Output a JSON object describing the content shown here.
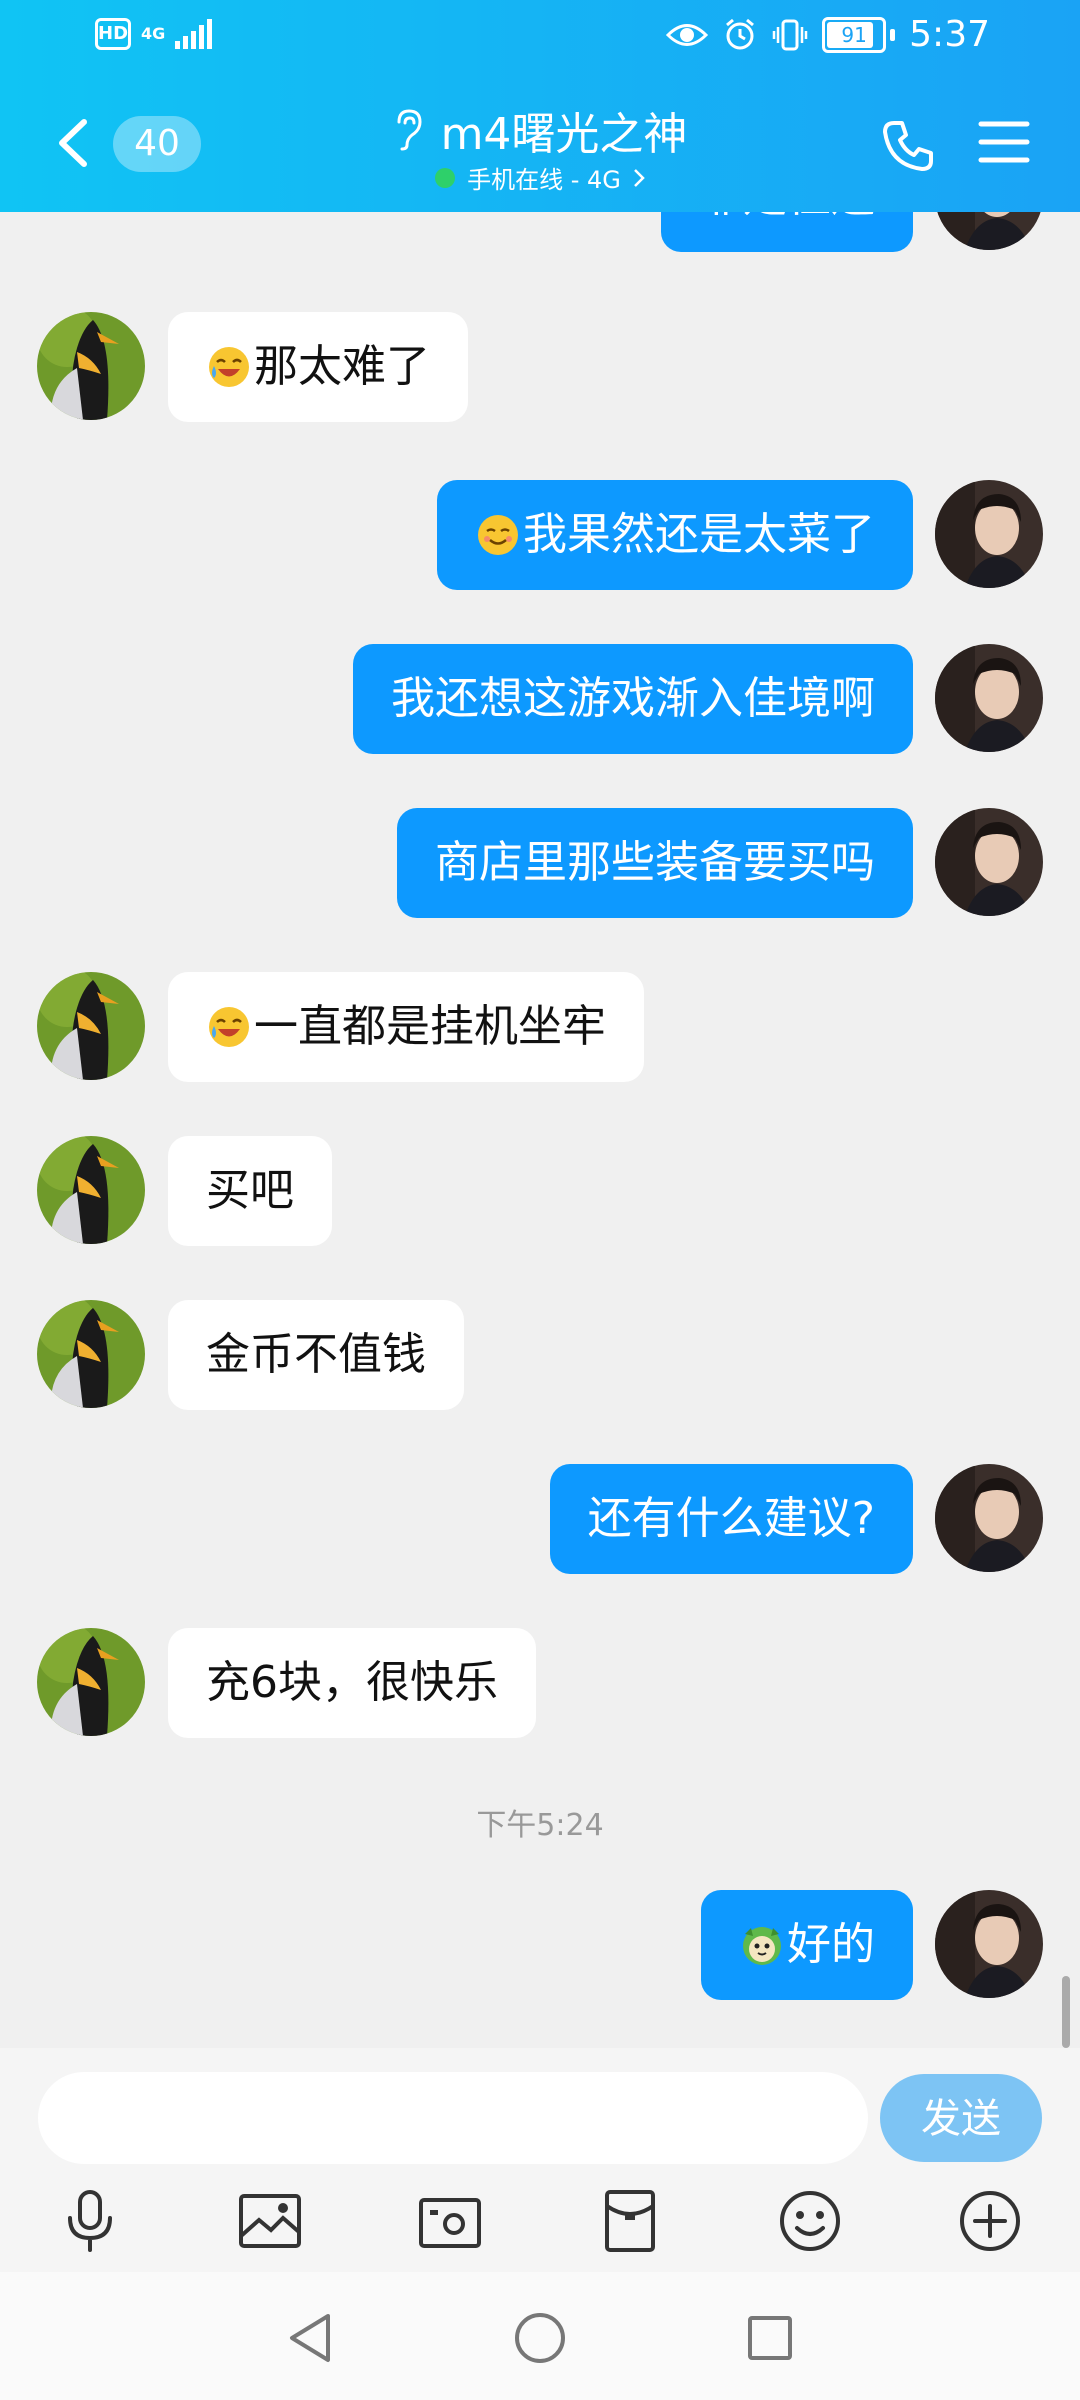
{
  "status_bar": {
    "network_type": "4G",
    "battery_level": "91",
    "time": "5:37"
  },
  "header": {
    "unread_count": "40",
    "contact_name": "m4曙光之神",
    "online_status": "手机在线 - 4G",
    "background_color": "#1aa3f5"
  },
  "messages": [
    {
      "side": "right",
      "text": "靠走位还",
      "emoji": null
    },
    {
      "side": "left",
      "text": "那太难了",
      "emoji": "tearful-laugh"
    },
    {
      "side": "right",
      "text": "我果然还是太菜了",
      "emoji": "content-smile"
    },
    {
      "side": "right",
      "text": "我还想这游戏渐入佳境啊",
      "emoji": null
    },
    {
      "side": "right",
      "text": "商店里那些装备要买吗",
      "emoji": null
    },
    {
      "side": "left",
      "text": "一直都是挂机坐牢",
      "emoji": "tearful-laugh"
    },
    {
      "side": "left",
      "text": "买吧",
      "emoji": null
    },
    {
      "side": "left",
      "text": "金币不值钱",
      "emoji": null
    },
    {
      "side": "right",
      "text": "还有什么建议?",
      "emoji": null
    },
    {
      "side": "left",
      "text": "充6块，很快乐",
      "emoji": null
    },
    {
      "side": "right",
      "text": "好的",
      "emoji": "green-cartoon"
    }
  ],
  "timestamp": "下午5:24",
  "input": {
    "placeholder": "",
    "value": "",
    "send_label": "发送"
  },
  "toolbar_icons": [
    "microphone-icon",
    "image-icon",
    "camera-icon",
    "red-packet-icon",
    "emoji-icon",
    "plus-icon"
  ],
  "colors": {
    "my_bubble": "#0d99ff",
    "their_bubble": "#ffffff",
    "send_button": "#7dc4f4",
    "online_dot": "#2ed06a"
  }
}
